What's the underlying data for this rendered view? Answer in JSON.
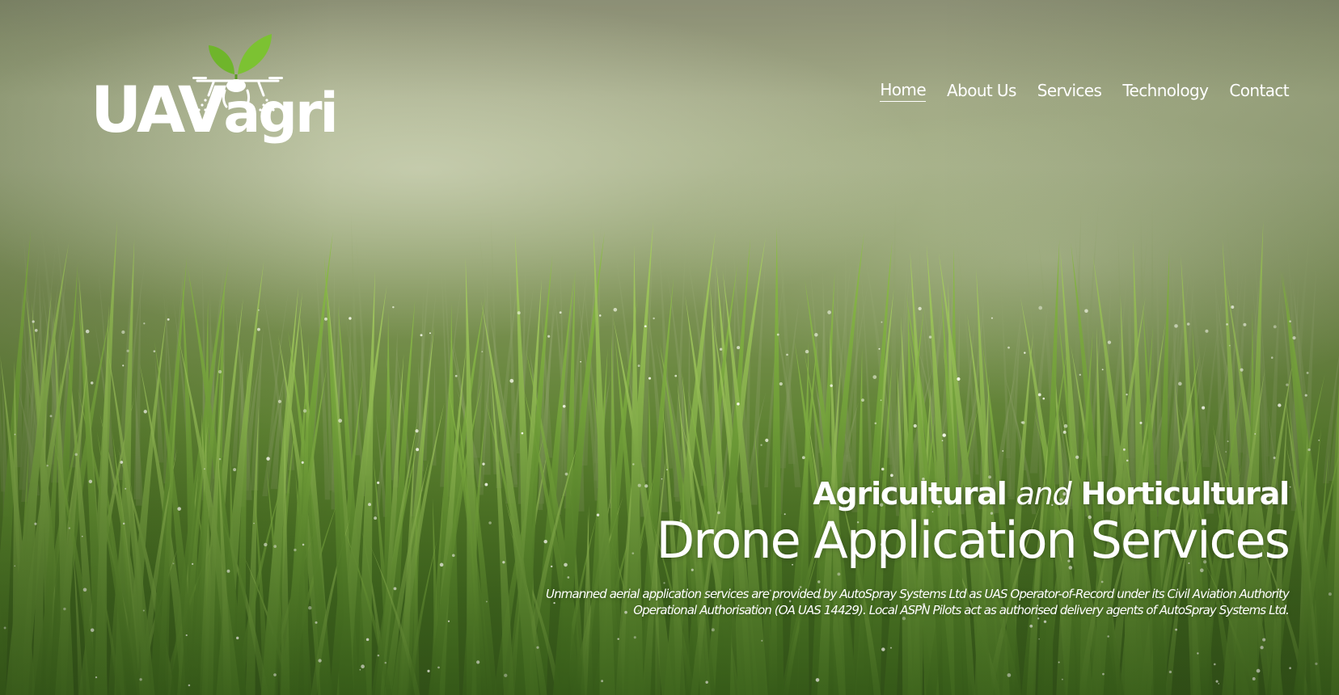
{
  "brand": {
    "logo_text_uav": "UAV",
    "logo_text_agri": "agri",
    "leaf_color": "#6fb52b",
    "logo_color": "#ffffff"
  },
  "nav": {
    "items": [
      {
        "label": "Home",
        "active": true
      },
      {
        "label": "About Us",
        "active": false
      },
      {
        "label": "Services",
        "active": false
      },
      {
        "label": "Technology",
        "active": false
      },
      {
        "label": "Contact",
        "active": false
      }
    ]
  },
  "hero": {
    "tagline_part1": "Agricultural",
    "tagline_and": "and",
    "tagline_part2": "Horticultural",
    "headline": "Drone Application Services",
    "disclaimer": "Unmanned aerial application services are provided by AutoSpray Systems Ltd as UAS Operator-of-Record under its Civil Aviation Authority Operational Authorisation (OA UAS 14429). Local ASPN Pilots act as authorised delivery agents of AutoSpray Systems Ltd."
  },
  "background": {
    "image": "green-grass-field-with-mist-icon",
    "sky_color": "#a7b08a",
    "grass_color": "#4f7626"
  }
}
